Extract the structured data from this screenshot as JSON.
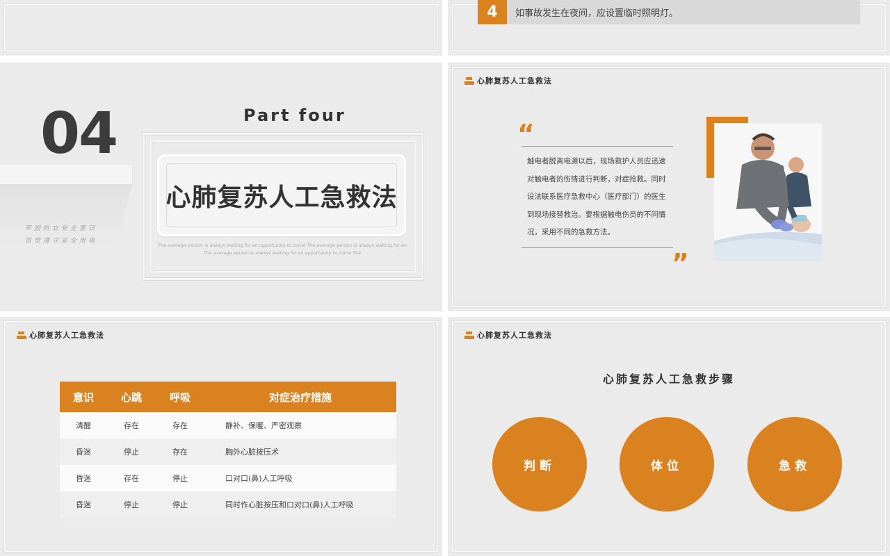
{
  "slide2": {
    "step_number": "4",
    "step_text": "如事故发生在夜间，应设置临时照明灯。"
  },
  "header": {
    "title": "心肺复苏人工急救法"
  },
  "section": {
    "number": "04",
    "part_label": "Part four",
    "title": "心肺复苏人工急救法",
    "motto_line1": "牢固树立安全意识",
    "motto_line2": "自觉遵守安全用电",
    "subtitle_en": "The average person is always waiting for an opportunity to come The average person is always waiting for an The average person is always waiting for an opportunity to come The"
  },
  "quote_slide": {
    "open_quote": "“",
    "close_quote": "”",
    "body": "触电者脱离电源以后，现场救护人员应迅速对触电者的伤情进行判断，对症抢救。同时设法联系医疗急救中心（医疗部门）的医生到现场接替救治。要根据触电伤员的不同情况，采用不同的急救方法。"
  },
  "table": {
    "headers": [
      "意识",
      "心跳",
      "呼吸",
      "对症治疗措施"
    ],
    "rows": [
      [
        "清醒",
        "存在",
        "存在",
        "静补、保暖、严密观察"
      ],
      [
        "昏迷",
        "停止",
        "存在",
        "胸外心脏按压术"
      ],
      [
        "昏迷",
        "存在",
        "停止",
        "口对口(鼻)人工呼吸"
      ],
      [
        "昏迷",
        "停止",
        "停止",
        "同时作心脏按压和口对口(鼻)人工呼吸"
      ]
    ]
  },
  "steps": {
    "title": "心肺复苏人工急救步骤",
    "items": [
      "判断",
      "体位",
      "急救"
    ]
  },
  "colors": {
    "accent": "#d9821f",
    "bg": "#ebebeb",
    "text": "#333333"
  }
}
